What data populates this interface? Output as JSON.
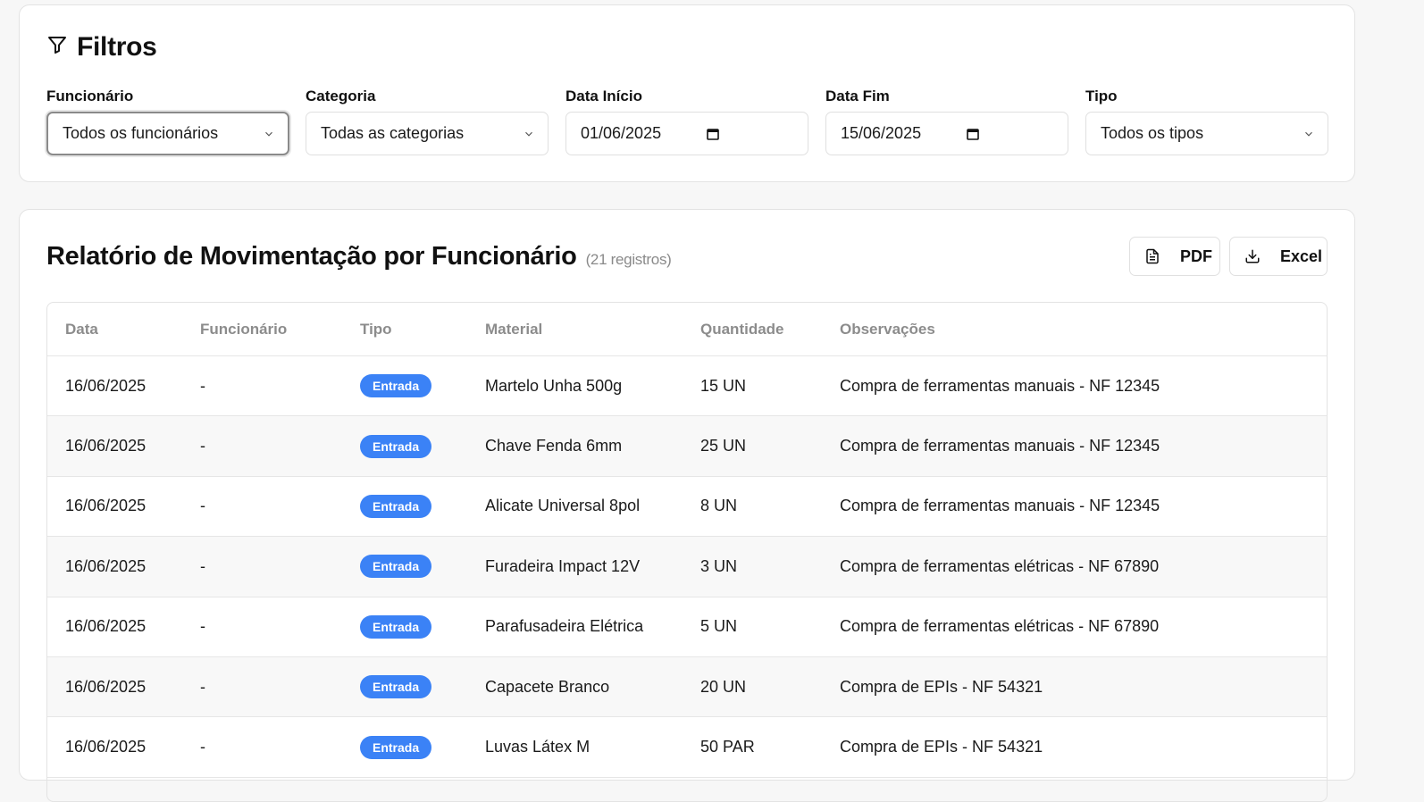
{
  "filters": {
    "title": "Filtros",
    "funcionario": {
      "label": "Funcionário",
      "value": "Todos os funcionários"
    },
    "categoria": {
      "label": "Categoria",
      "value": "Todas as categorias"
    },
    "data_inicio": {
      "label": "Data Início",
      "value": "01/06/2025"
    },
    "data_fim": {
      "label": "Data Fim",
      "value": "15/06/2025"
    },
    "tipo": {
      "label": "Tipo",
      "value": "Todos os tipos"
    }
  },
  "report": {
    "title": "Relatório de Movimentação por Funcionário",
    "count": "(21 registros)",
    "pdf_label": "PDF",
    "excel_label": "Excel",
    "badge_color": "#3b82f6",
    "columns": [
      "Data",
      "Funcionário",
      "Tipo",
      "Material",
      "Quantidade",
      "Observações"
    ],
    "rows": [
      {
        "data": "16/06/2025",
        "funcionario": "-",
        "tipo": "Entrada",
        "material": "Martelo Unha 500g",
        "quantidade": "15 UN",
        "obs": "Compra de ferramentas manuais - NF 12345"
      },
      {
        "data": "16/06/2025",
        "funcionario": "-",
        "tipo": "Entrada",
        "material": "Chave Fenda 6mm",
        "quantidade": "25 UN",
        "obs": "Compra de ferramentas manuais - NF 12345"
      },
      {
        "data": "16/06/2025",
        "funcionario": "-",
        "tipo": "Entrada",
        "material": "Alicate Universal 8pol",
        "quantidade": "8 UN",
        "obs": "Compra de ferramentas manuais - NF 12345"
      },
      {
        "data": "16/06/2025",
        "funcionario": "-",
        "tipo": "Entrada",
        "material": "Furadeira Impact 12V",
        "quantidade": "3 UN",
        "obs": "Compra de ferramentas elétricas - NF 67890"
      },
      {
        "data": "16/06/2025",
        "funcionario": "-",
        "tipo": "Entrada",
        "material": "Parafusadeira Elétrica",
        "quantidade": "5 UN",
        "obs": "Compra de ferramentas elétricas - NF 67890"
      },
      {
        "data": "16/06/2025",
        "funcionario": "-",
        "tipo": "Entrada",
        "material": "Capacete Branco",
        "quantidade": "20 UN",
        "obs": "Compra de EPIs - NF 54321"
      },
      {
        "data": "16/06/2025",
        "funcionario": "-",
        "tipo": "Entrada",
        "material": "Luvas Látex M",
        "quantidade": "50 PAR",
        "obs": "Compra de EPIs - NF 54321"
      }
    ]
  }
}
